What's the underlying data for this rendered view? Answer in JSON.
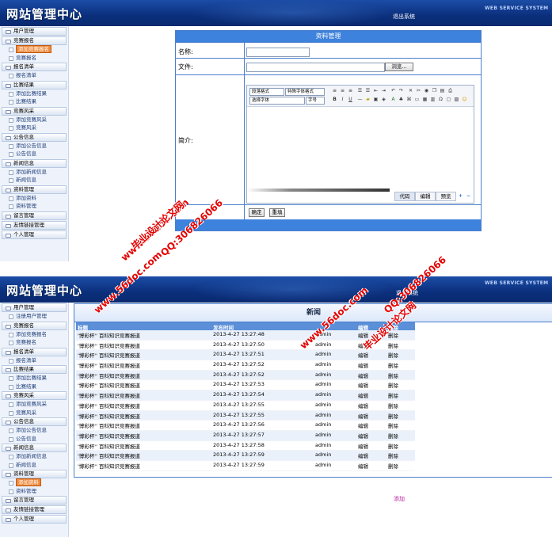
{
  "header": {
    "logo": "网站管理中心",
    "logout": "退出系统",
    "system_label": "WEB SERVICE SYSTEM"
  },
  "sidebar1": [
    {
      "type": "cat",
      "label": "用户管理"
    },
    {
      "type": "cat",
      "label": "竞赛报名"
    },
    {
      "type": "sub",
      "label": "添加竞赛报名",
      "selected": true
    },
    {
      "type": "sub",
      "label": "竞赛报名"
    },
    {
      "type": "cat",
      "label": "报名清单"
    },
    {
      "type": "sub",
      "label": "报名清单"
    },
    {
      "type": "cat",
      "label": "比赛结果"
    },
    {
      "type": "sub",
      "label": "添加比赛结果"
    },
    {
      "type": "sub",
      "label": "比赛结果"
    },
    {
      "type": "cat",
      "label": "竞赛风采"
    },
    {
      "type": "sub",
      "label": "添加竞赛风采"
    },
    {
      "type": "sub",
      "label": "竞赛风采"
    },
    {
      "type": "cat",
      "label": "公告信息"
    },
    {
      "type": "sub",
      "label": "添加公告信息"
    },
    {
      "type": "sub",
      "label": "公告信息"
    },
    {
      "type": "cat",
      "label": "新闻信息"
    },
    {
      "type": "sub",
      "label": "添加新闻信息"
    },
    {
      "type": "sub",
      "label": "新闻信息"
    },
    {
      "type": "cat",
      "label": "资料管理"
    },
    {
      "type": "sub",
      "label": "添加资料"
    },
    {
      "type": "sub",
      "label": "资料管理"
    },
    {
      "type": "cat",
      "label": "留言管理"
    },
    {
      "type": "cat",
      "label": "友情链接管理"
    },
    {
      "type": "cat",
      "label": "个人管理"
    }
  ],
  "form_panel": {
    "title": "资料管理",
    "name_label": "名称:",
    "file_label": "文件:",
    "browse_button": "浏览...",
    "intro_label": "简介:",
    "editor": {
      "para_format": "段落格式",
      "special_font": "特殊字体格式",
      "font_family": "选择字体",
      "font_size": "字号",
      "tab_code": "代码",
      "tab_edit": "编辑",
      "tab_preview": "预览"
    },
    "confirm_button": "确定",
    "reset_button": "重填"
  },
  "sidebar2": [
    {
      "type": "cat",
      "label": "用户管理"
    },
    {
      "type": "sub",
      "label": "注册用户管理"
    },
    {
      "type": "cat",
      "label": "竞赛报名"
    },
    {
      "type": "sub",
      "label": "添加竞赛报名"
    },
    {
      "type": "sub",
      "label": "竞赛报名"
    },
    {
      "type": "cat",
      "label": "报名清单"
    },
    {
      "type": "sub",
      "label": "报名清单"
    },
    {
      "type": "cat",
      "label": "比赛结果"
    },
    {
      "type": "sub",
      "label": "添加比赛结果"
    },
    {
      "type": "sub",
      "label": "比赛结果"
    },
    {
      "type": "cat",
      "label": "竞赛风采"
    },
    {
      "type": "sub",
      "label": "添加竞赛风采"
    },
    {
      "type": "sub",
      "label": "竞赛风采"
    },
    {
      "type": "cat",
      "label": "公告信息"
    },
    {
      "type": "sub",
      "label": "添加公告信息"
    },
    {
      "type": "sub",
      "label": "公告信息"
    },
    {
      "type": "cat",
      "label": "新闻信息"
    },
    {
      "type": "sub",
      "label": "添加新闻信息"
    },
    {
      "type": "sub",
      "label": "新闻信息"
    },
    {
      "type": "cat",
      "label": "资料管理"
    },
    {
      "type": "sub",
      "label": "添加资料",
      "selected": true
    },
    {
      "type": "sub",
      "label": "资料管理"
    },
    {
      "type": "cat",
      "label": "留言管理"
    },
    {
      "type": "cat",
      "label": "友情链接管理"
    },
    {
      "type": "cat",
      "label": "个人管理"
    }
  ],
  "news_panel": {
    "title": "新闻",
    "columns": [
      "标题",
      "发布时间",
      "",
      "编辑",
      "删除"
    ],
    "rows": [
      [
        "'博彩杯'' 百科知识竞赛报道",
        "2013-4-27 13:27:48",
        "admin",
        "编辑",
        "删除"
      ],
      [
        "'博彩杯'' 百科知识竞赛报道",
        "2013-4-27 13:27:50",
        "admin",
        "编辑",
        "删除"
      ],
      [
        "'博彩杯'' 百科知识竞赛报道",
        "2013-4-27 13:27:51",
        "admin",
        "编辑",
        "删除"
      ],
      [
        "'博彩杯'' 百科知识竞赛报道",
        "2013-4-27 13:27:52",
        "admin",
        "编辑",
        "删除"
      ],
      [
        "'博彩杯'' 百科知识竞赛报道",
        "2013-4-27 13:27:52",
        "admin",
        "编辑",
        "删除"
      ],
      [
        "'博彩杯'' 百科知识竞赛报道",
        "2013-4-27 13:27:53",
        "admin",
        "编辑",
        "删除"
      ],
      [
        "'博彩杯'' 百科知识竞赛报道",
        "2013-4-27 13:27:54",
        "admin",
        "编辑",
        "删除"
      ],
      [
        "'博彩杯'' 百科知识竞赛报道",
        "2013-4-27 13:27:55",
        "admin",
        "编辑",
        "删除"
      ],
      [
        "'博彩杯'' 百科知识竞赛报道",
        "2013-4-27 13:27:55",
        "admin",
        "编辑",
        "删除"
      ],
      [
        "'博彩杯'' 百科知识竞赛报道",
        "2013-4-27 13:27:56",
        "admin",
        "编辑",
        "删除"
      ],
      [
        "'博彩杯'' 百科知识竞赛报道",
        "2013-4-27 13:27:57",
        "admin",
        "编辑",
        "删除"
      ],
      [
        "'博彩杯'' 百科知识竞赛报道",
        "2013-4-27 13:27:58",
        "admin",
        "编辑",
        "删除"
      ],
      [
        "'博彩杯'' 百科知识竞赛报道",
        "2013-4-27 13:27:59",
        "admin",
        "编辑",
        "删除"
      ],
      [
        "'博彩杯'' 百科知识竞赛报道",
        "2013-4-27 13:27:59",
        "admin",
        "编辑",
        "删除"
      ]
    ],
    "add_link": "添加"
  },
  "watermarks": {
    "site": "www.56doc.com",
    "brand": "毕业设计论文网",
    "qq": "QQ:306826066"
  }
}
